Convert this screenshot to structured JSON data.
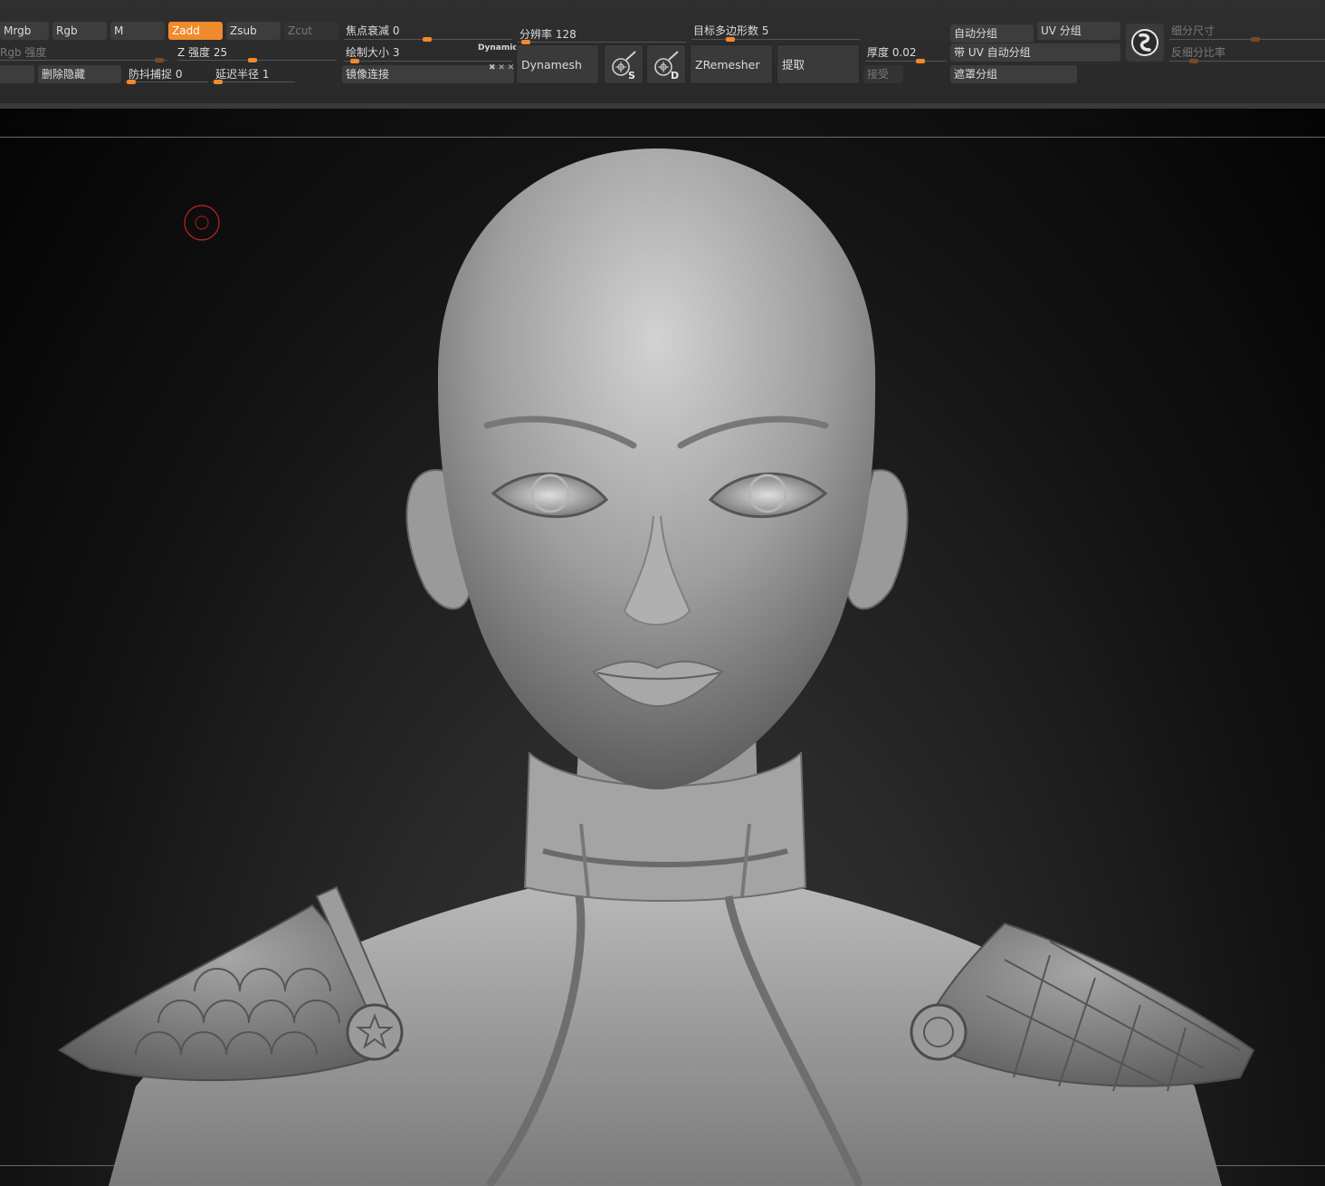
{
  "toolbar": {
    "mrgb": "Mrgb",
    "rgb": "Rgb",
    "m": "M",
    "zadd": "Zadd",
    "zsub": "Zsub",
    "zcut": "Zcut",
    "rgb_intensity": "Rgb 强度",
    "z_intensity": "Z 强度 25",
    "delete_hidden": "删除隐藏",
    "lazy_snap": "防抖捕捉 0",
    "lazy_radius": "延迟半径 1",
    "focal_shift": "焦点衰减 0",
    "draw_size": "绘制大小 3",
    "dynamic": "Dynamic",
    "mirror_weld": "镜像连接",
    "resolution": "分辨率 128",
    "dynamesh": "Dynamesh",
    "target_polygons": "目标多边形数 5",
    "zremesher": "ZRemesher",
    "extract": "提取",
    "thickness": "厚度 0.02",
    "accept": "接受",
    "auto_groups": "自动分组",
    "uv_groups": "UV 分组",
    "auto_groups_uv": "带 UV 自动分组",
    "mask_groups": "遮罩分组",
    "subdiv_size": "细分尺寸",
    "anti_subdiv_ratio": "反细分比率",
    "s_label": "S",
    "d_label": "D"
  },
  "state": {
    "z_intensity": 25,
    "focal_shift": 0,
    "draw_size": 3,
    "lazy_snap": 0,
    "lazy_radius": 1,
    "resolution": 128,
    "target_polygons": 5,
    "thickness": 0.02,
    "active_mode": "Zadd"
  },
  "colors": {
    "accent": "#f08a2c",
    "cursor_ring": "#c0261f"
  },
  "icons": {
    "smooth_s": "brush-s-icon",
    "smooth_d": "brush-d-icon",
    "logo": "zbrush-logo-icon"
  }
}
